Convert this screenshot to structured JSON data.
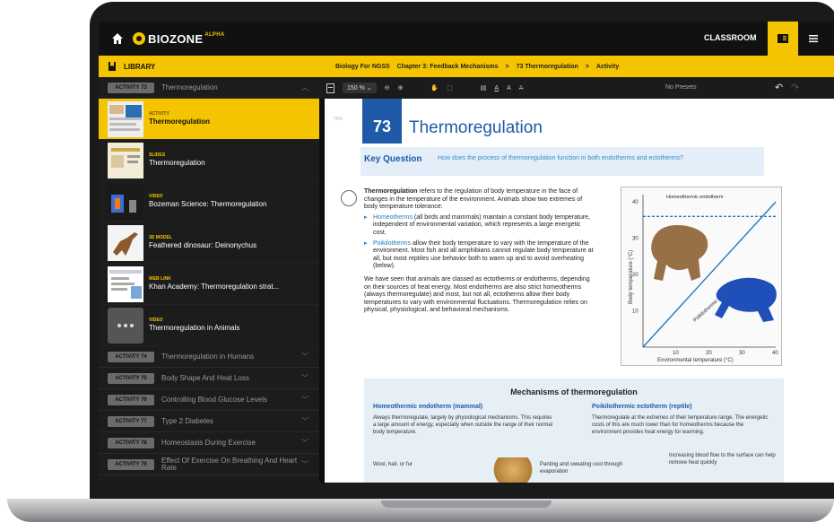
{
  "topbar": {
    "brand": "BIOZONE",
    "brand_tag": "ALPHA",
    "classroom_label": "CLASSROOM"
  },
  "sidebar": {
    "header": "LIBRARY",
    "current_activity": {
      "badge": "ACTIVITY 73",
      "title": "Thermoregulation"
    },
    "resources": [
      {
        "type": "ACTIVITY",
        "title": "Thermoregulation",
        "active": true
      },
      {
        "type": "SLIDES",
        "title": "Thermoregulation"
      },
      {
        "type": "VIDEO",
        "title": "Bozeman Science: Thermoregulation",
        "label": "Thermoregulation"
      },
      {
        "type": "3D MODEL",
        "title": "Feathered dinosaur: Deinonychus"
      },
      {
        "type": "WEB LINK",
        "title": "Khan Academy: Thermoregulation strat..."
      },
      {
        "type": "VIDEO",
        "title": "Thermoregulation in Animals"
      }
    ],
    "activities": [
      {
        "badge": "ACTIVITY 74",
        "title": "Thermoregulation in Humans"
      },
      {
        "badge": "ACTIVITY 75",
        "title": "Body Shape And Heat Loss"
      },
      {
        "badge": "ACTIVITY 76",
        "title": "Controlling Blood Glucose Levels"
      },
      {
        "badge": "ACTIVITY 77",
        "title": "Type 2 Diabetes"
      },
      {
        "badge": "ACTIVITY 78",
        "title": "Homeostasis During Exercise"
      },
      {
        "badge": "ACTIVITY 79",
        "title": "Effect Of Exercise On Breathing And Heart Rate"
      }
    ]
  },
  "breadcrumb": {
    "items": [
      "Biology For NGSS",
      "Chapter 3: Feedback Mechanisms",
      "73 Thermoregulation",
      "Activity"
    ],
    "separator": ">"
  },
  "toolbar": {
    "zoom": "150 %",
    "presets": "No Presets"
  },
  "page": {
    "side_tag": "TRA",
    "number": "73",
    "title": "Thermoregulation",
    "key_question_label": "Key Question",
    "key_question": "How does the process of thermoregulation function in both endotherms and ectotherms?",
    "intro_term": "Thermoregulation",
    "intro": " refers to the regulation of body temperature in the face of changes in the temperature of the environment. Animals show two extremes of body temperature tolerance:",
    "bullet1_term": "Homeotherms",
    "bullet1": " (all birds and mammals) maintain a constant body temperature, independent of environmental variation, which represents a large energetic cost.",
    "bullet2_term": "Poikilotherms",
    "bullet2": " allow their body temperature to vary with the temperature of the environment. Most fish and all amphibians cannot regulate body temperature at all, but most reptiles use behavior both to warm up and to avoid overheating (below).",
    "para2": "We have seen that animals are classed as ectotherms or endotherms, depending on their sources of heat energy. Most endotherms are also strict homeotherms (always thermoregulate) and most, but not all, ectotherms allow their body temperatures to vary with environmental fluctuations. Thermoregulation relies on physical, physiological, and behavioral mechanisms.",
    "mechanisms_title": "Mechanisms of thermoregulation",
    "mech_left_title": "Homeothermic endotherm (mammal)",
    "mech_left_text": "Always thermoregulate, largely by physiological mechanisms. This requires a large amount of energy, especially when outside the range of their normal body temperature.",
    "mech_left_label": "Wool, hair, or fur",
    "mech_mid_label": "Panting and sweating cool through evaporation",
    "mech_right_title": "Poikilothermic ectotherm (reptile)",
    "mech_right_text": "Thermoregulate at the extremes of their temperature range. The energetic costs of this are much lower than for homeotherms because the environment provides heat energy for warming.",
    "mech_right_label": "Increasing blood flow to the surface can help remove heat quickly"
  },
  "chart_data": {
    "type": "line",
    "xlabel": "Environmental temperature (°C)",
    "ylabel": "Body temperature (°C)",
    "xticks": [
      10,
      20,
      30,
      40
    ],
    "yticks": [
      10,
      20,
      30,
      40
    ],
    "xlim": [
      0,
      40
    ],
    "ylim": [
      0,
      42
    ],
    "series": [
      {
        "name": "Homeothermic endotherm",
        "x": [
          0,
          40
        ],
        "y": [
          36,
          36
        ],
        "color": "#1e7ac0",
        "style": "dashed"
      },
      {
        "name": "Poikilothermic ectotherm",
        "x": [
          0,
          40
        ],
        "y": [
          0,
          40
        ],
        "color": "#1e7ac0",
        "style": "solid"
      }
    ]
  }
}
